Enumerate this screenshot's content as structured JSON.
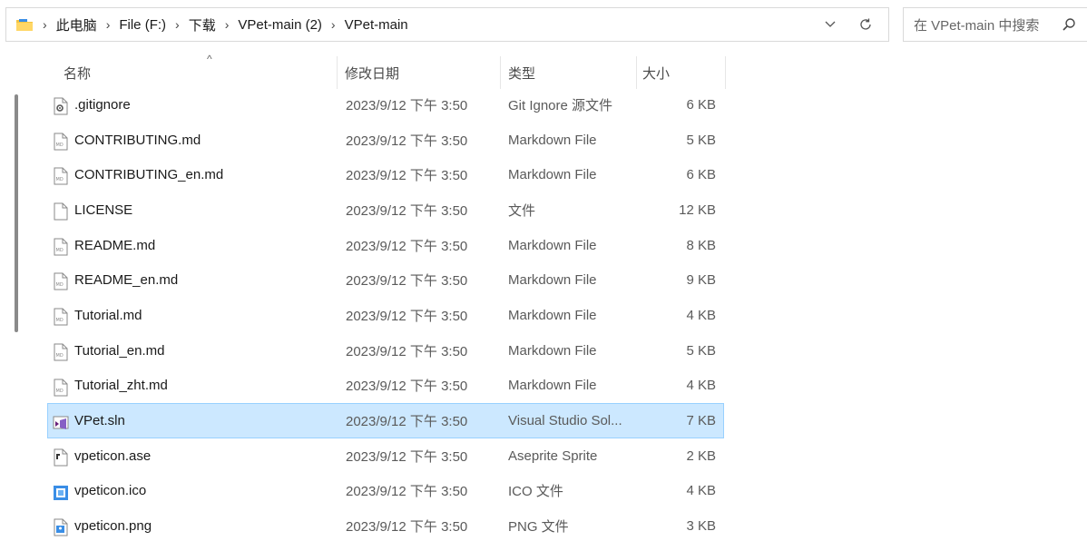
{
  "address_bar": {
    "breadcrumbs": [
      "此电脑",
      "File (F:)",
      "下载",
      "VPet-main (2)",
      "VPet-main"
    ]
  },
  "search": {
    "placeholder": "在 VPet-main 中搜索"
  },
  "columns": {
    "name": "名称",
    "date": "修改日期",
    "type": "类型",
    "size": "大小"
  },
  "files": [
    {
      "name": ".gitignore",
      "date": "2023/9/12 下午 3:50",
      "type": "Git Ignore 源文件",
      "size": "6 KB",
      "icon": "gitignore-file-icon"
    },
    {
      "name": "CONTRIBUTING.md",
      "date": "2023/9/12 下午 3:50",
      "type": "Markdown File",
      "size": "5 KB",
      "icon": "markdown-file-icon"
    },
    {
      "name": "CONTRIBUTING_en.md",
      "date": "2023/9/12 下午 3:50",
      "type": "Markdown File",
      "size": "6 KB",
      "icon": "markdown-file-icon"
    },
    {
      "name": "LICENSE",
      "date": "2023/9/12 下午 3:50",
      "type": "文件",
      "size": "12 KB",
      "icon": "blank-file-icon"
    },
    {
      "name": "README.md",
      "date": "2023/9/12 下午 3:50",
      "type": "Markdown File",
      "size": "8 KB",
      "icon": "markdown-file-icon"
    },
    {
      "name": "README_en.md",
      "date": "2023/9/12 下午 3:50",
      "type": "Markdown File",
      "size": "9 KB",
      "icon": "markdown-file-icon"
    },
    {
      "name": "Tutorial.md",
      "date": "2023/9/12 下午 3:50",
      "type": "Markdown File",
      "size": "4 KB",
      "icon": "markdown-file-icon"
    },
    {
      "name": "Tutorial_en.md",
      "date": "2023/9/12 下午 3:50",
      "type": "Markdown File",
      "size": "5 KB",
      "icon": "markdown-file-icon"
    },
    {
      "name": "Tutorial_zht.md",
      "date": "2023/9/12 下午 3:50",
      "type": "Markdown File",
      "size": "4 KB",
      "icon": "markdown-file-icon"
    },
    {
      "name": "VPet.sln",
      "date": "2023/9/12 下午 3:50",
      "type": "Visual Studio Sol...",
      "size": "7 KB",
      "icon": "visual-studio-solution-icon",
      "selected": true
    },
    {
      "name": "vpeticon.ase",
      "date": "2023/9/12 下午 3:50",
      "type": "Aseprite Sprite",
      "size": "2 KB",
      "icon": "aseprite-file-icon"
    },
    {
      "name": "vpeticon.ico",
      "date": "2023/9/12 下午 3:50",
      "type": "ICO 文件",
      "size": "4 KB",
      "icon": "ico-file-icon"
    },
    {
      "name": "vpeticon.png",
      "date": "2023/9/12 下午 3:50",
      "type": "PNG 文件",
      "size": "3 KB",
      "icon": "png-file-icon"
    }
  ],
  "colors": {
    "selection_bg": "#cce8ff",
    "selection_border": "#99d1ff",
    "folder_yellow": "#f4c542"
  }
}
